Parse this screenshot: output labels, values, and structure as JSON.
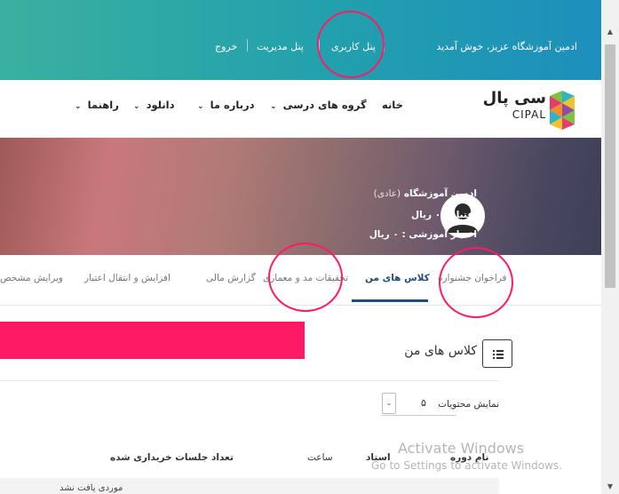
{
  "top_bar": {
    "welcome": "ادمین آموزشگاه عزیز، خوش آمدید",
    "user_panel": "پنل کاربری",
    "admin_panel": "پنل مدیریت",
    "logout": "خروج"
  },
  "nav": {
    "logo_text": "سی پال",
    "logo_sub": "CIPAL",
    "home": "خانه",
    "groups": "گروه های درسی",
    "about": "درباره ما",
    "download": "دانلود",
    "guide": "راهنما",
    "chevron": "⌄"
  },
  "profile": {
    "name": "ادمین آموزشگاه",
    "type": "(عادی)",
    "credit": "اعتبار : ۰ ریال",
    "edu_credit": "اعتبار آموزشی : ۰ ریال"
  },
  "tabs": {
    "festival": "فراخوان جشنواره",
    "my_classes": "کلاس های من",
    "research": "تحقیقات مد و معماری",
    "financial": "گزارش مالی",
    "transfer": "افزایش و انتقال اعتبار",
    "edit_profile": "ویرایش مشخص"
  },
  "section": {
    "title": "کلاس های من",
    "show_label": "نمایش محتویات",
    "page_size": "۵",
    "columns": {
      "course_name": "نام دوره",
      "teacher": "استاد",
      "time": "ساعت",
      "sessions": "تعداد جلسات خریداری شده"
    },
    "empty": "موردی یافت نشد"
  },
  "watermark": {
    "title": "Activate Windows",
    "subtitle": "Go to Settings to activate Windows."
  },
  "colors": {
    "accent": "#ff1a66",
    "tab_active": "#1f4e7a",
    "topbar": "#22a0ad"
  }
}
